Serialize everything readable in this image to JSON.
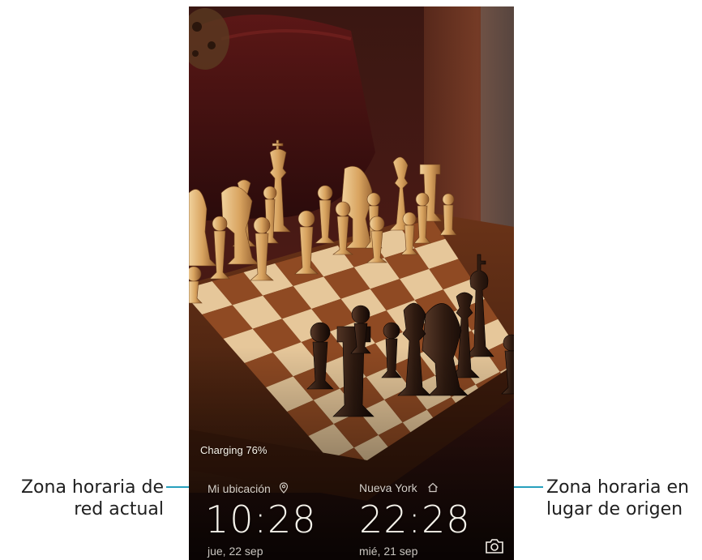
{
  "callouts": {
    "left": {
      "line1": "Zona horaria de",
      "line2": "red actual"
    },
    "right": {
      "line1": "Zona horaria en",
      "line2": "lugar de origen"
    },
    "color": "#27a0bd"
  },
  "lockscreen": {
    "charging_status": "Charging 76%",
    "clocks": [
      {
        "location": "Mi ubicación",
        "icon": "location-pin-icon",
        "time": "10:28",
        "date": "jue, 22 sep"
      },
      {
        "location": "Nueva York",
        "icon": "home-icon",
        "time": "22:28",
        "date": "mié, 21 sep"
      }
    ],
    "shortcut_icon": "camera-icon",
    "wallpaper": "chess-board-wallpaper"
  }
}
